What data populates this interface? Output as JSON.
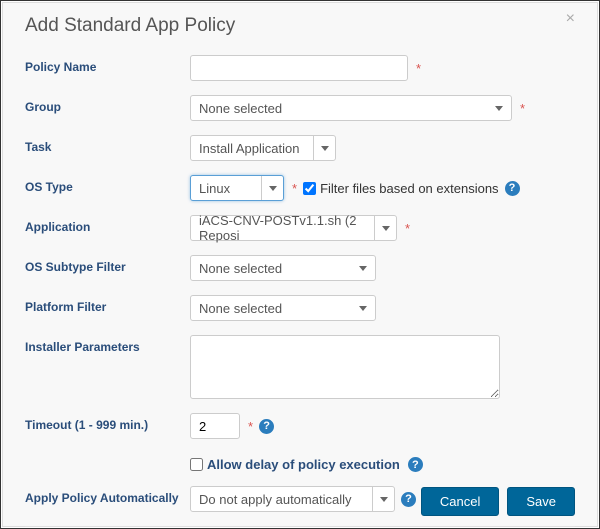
{
  "dialog": {
    "title": "Add Standard App Policy",
    "close": "×"
  },
  "labels": {
    "policyName": "Policy Name",
    "group": "Group",
    "task": "Task",
    "osType": "OS Type",
    "application": "Application",
    "osSubtypeFilter": "OS Subtype Filter",
    "platformFilter": "Platform Filter",
    "installerParameters": "Installer Parameters",
    "timeout": "Timeout (1 - 999 min.)",
    "applyPolicyAutomatically": "Apply Policy Automatically"
  },
  "values": {
    "policyName": "",
    "group": "None selected",
    "task": "Install Application",
    "osType": "Linux",
    "filterFilesChecked": true,
    "filterFilesLabel": "Filter files based on extensions",
    "application": "iACS-CNV-POSTv1.1.sh (2 Reposi",
    "osSubtypeFilter": "None selected",
    "platformFilter": "None selected",
    "installerParameters": "",
    "timeout": "2",
    "allowDelayChecked": false,
    "allowDelayLabel": "Allow delay of policy execution",
    "applyPolicyAutomatically": "Do not apply automatically"
  },
  "buttons": {
    "cancel": "Cancel",
    "save": "Save"
  },
  "required": "*",
  "help": "?"
}
